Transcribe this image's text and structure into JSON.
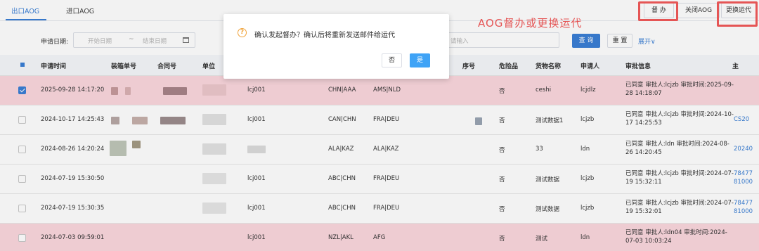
{
  "tabs": [
    {
      "label": "出口AOG",
      "active": true
    },
    {
      "label": "进口AOG",
      "active": false
    }
  ],
  "actions": {
    "supervise_label": "督 办",
    "close_label": "关闭AOG",
    "change_carrier_label": "更换运代"
  },
  "annotation": "AOG督办或更换运代",
  "filter": {
    "date_label": "申请日期:",
    "date_start_placeholder": "开始日期",
    "date_separator": "~",
    "date_end_placeholder": "结束日期",
    "search_placeholder": "请输入",
    "query_label": "查 询",
    "reset_label": "重 置",
    "expand_label": "展开∨"
  },
  "table": {
    "headers": [
      "申请时间",
      "装箱单号",
      "合同号",
      "单位",
      "序号",
      "危险品",
      "货物名称",
      "申请人",
      "审批信息",
      "主"
    ],
    "rows": [
      {
        "checked": true,
        "highlight": true,
        "time": "2025-09-28 14:17:20",
        "unit": "lcj001",
        "route1": "CHN|AAA",
        "route2": "AMS|NLD",
        "dangerous": "否",
        "goods": "ceshi",
        "applicant": "lcjdlz",
        "approval": "已同意 审批人:lcjzb 审批时间:2025-09-28 14:18:07",
        "main": ""
      },
      {
        "checked": false,
        "highlight": false,
        "time": "2024-10-17 14:25:43",
        "unit": "lcj001",
        "route1": "CAN|CHN",
        "route2": "FRA|DEU",
        "dangerous": "否",
        "goods": "测试数据1",
        "applicant": "lcjzb",
        "approval": "已同意 审批人:lcjzb 审批时间:2024-10-17 14:25:53",
        "main": "CS20"
      },
      {
        "checked": false,
        "highlight": false,
        "time": "2024-08-26 14:20:24",
        "unit": "",
        "route1": "ALA|KAZ",
        "route2": "ALA|KAZ",
        "dangerous": "否",
        "goods": "33",
        "applicant": "ldn",
        "approval": "已同意 审批人:ldn 审批时间:2024-08-26 14:20:45",
        "main": "20240"
      },
      {
        "checked": false,
        "highlight": false,
        "time": "2024-07-19 15:30:50",
        "unit": "lcj001",
        "route1": "ABC|CHN",
        "route2": "FRA|DEU",
        "dangerous": "否",
        "goods": "测试数据",
        "applicant": "lcjzb",
        "approval": "已同意 审批人:lcjzb 审批时间:2024-07-19 15:32:11",
        "main": "78477 81000"
      },
      {
        "checked": false,
        "highlight": false,
        "time": "2024-07-19 15:30:35",
        "unit": "lcj001",
        "route1": "ABC|CHN",
        "route2": "FRA|DEU",
        "dangerous": "否",
        "goods": "测试数据",
        "applicant": "lcjzb",
        "approval": "已同意 审批人:lcjzb 审批时间:2024-07-19 15:32:01",
        "main": "78477 81000"
      },
      {
        "checked": false,
        "highlight": true,
        "time": "2024-07-03 09:59:01",
        "unit": "lcj001",
        "route1": "NZL|AKL",
        "route2": "AFG",
        "dangerous": "否",
        "goods": "测试",
        "applicant": "ldn",
        "approval": "已同意 审批人:ldn04 审批时间:2024-07-03 10:03:24",
        "main": ""
      }
    ]
  },
  "dialog": {
    "message": "确认发起督办？确认后将重新发送邮件给运代",
    "no_label": "否",
    "yes_label": "是"
  },
  "colors": {
    "accent": "#3a7fd5",
    "highlight_row": "#fbd7de",
    "annotation_red": "#f25a5a",
    "warning": "#f0a33a"
  }
}
